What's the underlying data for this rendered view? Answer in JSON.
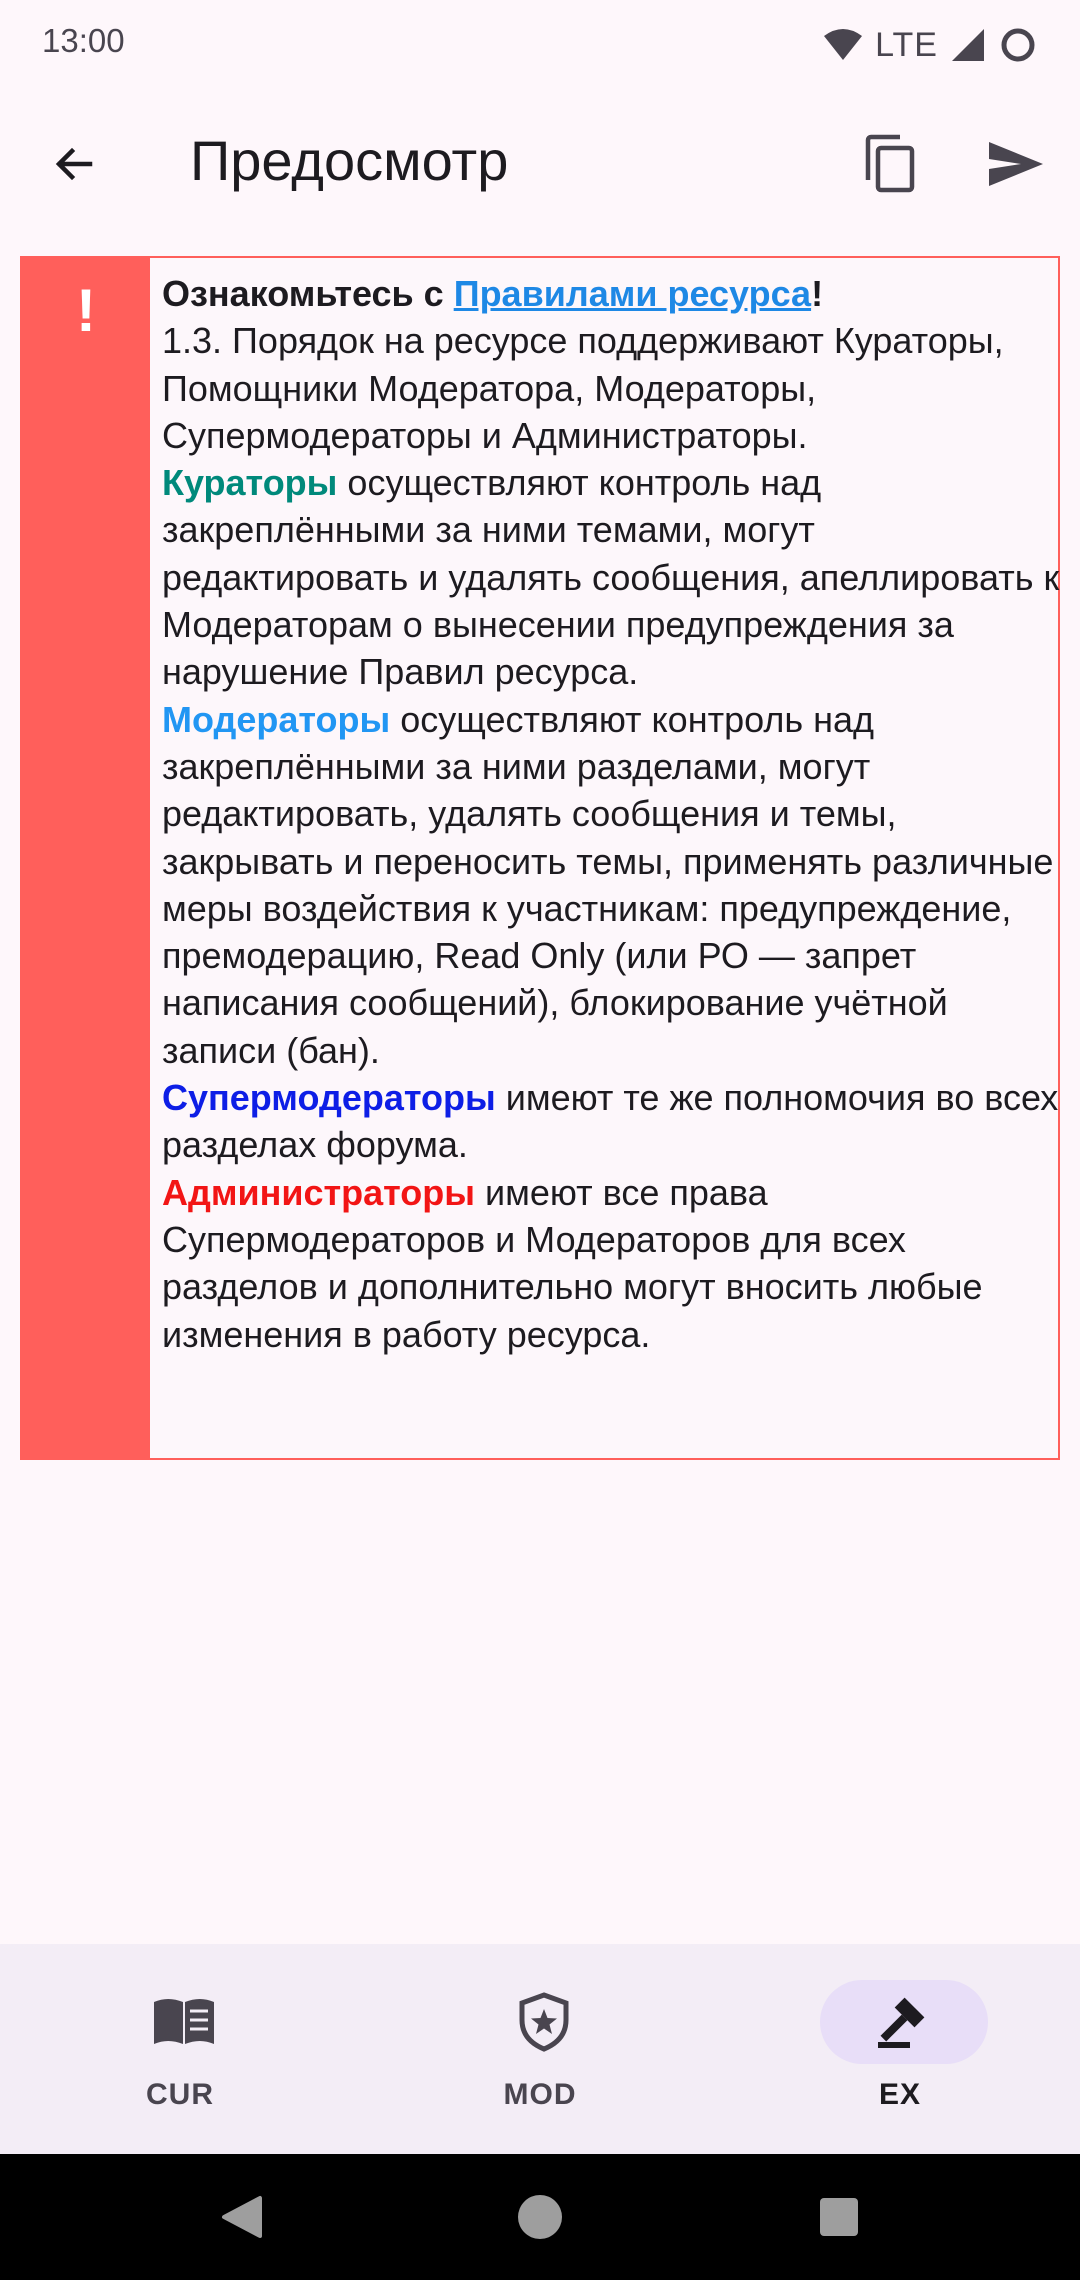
{
  "status": {
    "time": "13:00",
    "network": "LTE"
  },
  "appbar": {
    "title": "Предосмотр",
    "back_icon": "arrow-back-icon",
    "copy_icon": "copy-icon",
    "send_icon": "send-icon"
  },
  "notice": {
    "icon": "!",
    "accent_color": "#ff5f5b",
    "intro_prefix": "Ознакомьтесь с ",
    "intro_link": "Правилами ресурса",
    "intro_suffix": "!",
    "rule_text": "1.3. Порядок на ресурсе поддерживают Кураторы, Помощники Модератора, Модераторы, Супермодераторы и Администраторы.",
    "curators_label": "Кураторы",
    "curators_text": " осуществляют контроль над закреплёнными за ними темами, могут редактировать и удалять сообщения, апеллировать к Модераторам о вынесении предупреждения за нарушение Правил ресурса.",
    "moderators_label": "Модераторы",
    "moderators_text": " осуществляют контроль над закреплёнными за ними разделами, могут редактировать, удалять сообщения и темы, закрывать и переносить темы, применять различные меры воздействия к участникам: предупреждение, премодерацию, Read Only (или РО — запрет написания сообщений), блокирование учётной записи (бан).",
    "supermoderators_label": "Супермодераторы",
    "supermoderators_text": " имеют те же полномочия во всех разделах форума.",
    "admins_label": "Администраторы",
    "admins_text": " имеют все права Супермодераторов и Модераторов для всех разделов и дополнительно могут вносить любые изменения в работу ресурса."
  },
  "bottom_nav": {
    "items": [
      {
        "label": "CUR",
        "icon": "book-icon",
        "active": false
      },
      {
        "label": "MOD",
        "icon": "shield-star-icon",
        "active": false
      },
      {
        "label": "EX",
        "icon": "gavel-icon",
        "active": true
      }
    ]
  },
  "colors": {
    "curators": "#00897b",
    "moderators": "#2196f3",
    "supermoderators": "#0d1ee6",
    "admins": "#f21515",
    "link": "#1e88e5"
  }
}
